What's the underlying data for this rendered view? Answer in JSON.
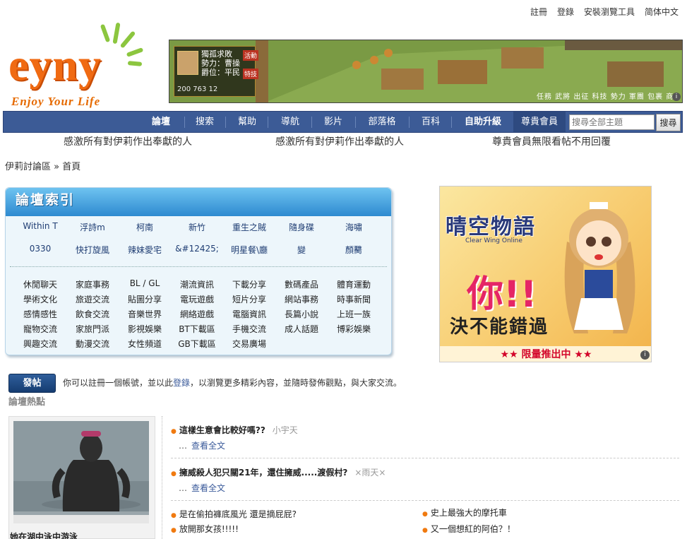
{
  "top_links": [
    "註冊",
    "登錄",
    "安裝瀏覽工具",
    "简体中文"
  ],
  "logo": {
    "word": "eyny",
    "slogan": "Enjoy Your Life"
  },
  "banner": {
    "info_lines": [
      "獨孤求敗",
      "勢力：曹操",
      "爵位：平民"
    ],
    "stats": "200  763  12",
    "tags": [
      "活動",
      "特技"
    ],
    "strip": "任務 武將 出征 科技 勢力 軍團 包裹 商"
  },
  "nav": {
    "items": [
      "論壇",
      "搜索",
      "幫助",
      "導航",
      "影片",
      "部落格",
      "百科",
      "自助升級",
      "尊貴會員"
    ],
    "search_placeholder": "搜尋全部主題",
    "search_button": "搜尋"
  },
  "notices": [
    "感激所有對伊莉作出奉獻的人",
    "感激所有對伊莉作出奉獻的人",
    "尊貴會員無限看帖不用回覆"
  ],
  "breadcrumb": {
    "home": "伊莉討論區",
    "sep": "»",
    "current": "首頁"
  },
  "forum_index": {
    "title": "論壇索引",
    "row1": [
      "Within T",
      "浮詩m",
      "柯南",
      "新竹",
      "重生之賊",
      "隨身碟",
      "海嘯"
    ],
    "row2": [
      "0330",
      "快打旋風",
      "辣妹愛宅",
      "&#12425;",
      "明星餐\\廳",
      "變",
      "顏臡"
    ],
    "columns": [
      [
        "休閒聊天",
        "學術文化",
        "感情感性",
        "寵物交流",
        "興趣交流"
      ],
      [
        "家庭事務",
        "旅遊交流",
        "飲食交流",
        "家旅門派",
        "動漫交流"
      ],
      [
        "BL / GL",
        "貼圖分享",
        "音樂世界",
        "影視娛樂",
        "女性頻道"
      ],
      [
        "潮流資訊",
        "電玩遊戲",
        "網絡遊戲",
        "BT下載區",
        "GB下載區"
      ],
      [
        "下載分享",
        "短片分享",
        "電腦資訊",
        "手機交流",
        "交易廣場"
      ],
      [
        "數碼產品",
        "網站事務",
        "長篇小說",
        "成人話題"
      ],
      [
        "體育運動",
        "時事新聞",
        "上班一族",
        "博彩娛樂"
      ]
    ]
  },
  "ad": {
    "logo": "晴空物語",
    "logo_sub": "Clear Wing Online",
    "headline": "你!!",
    "main": "決不能錯過",
    "sub": "★★ 限量推出中 ★★"
  },
  "post_button": "發帖",
  "intro": {
    "before": "你可以註冊一個帳號，並以此",
    "link": "登錄",
    "after": "，以瀏覽更多精彩內容，並隨時發佈觀點，與大家交流。"
  },
  "hot": {
    "title": "論壇熱點",
    "featured": [
      {
        "title": "這樣生意會比較好嗎??",
        "author": "小宇天",
        "more": "查看全文"
      },
      {
        "title": "擁威殺人犯只關21年，還住擁威.....渡假村?",
        "author": "×雨天×",
        "more": "查看全文"
      }
    ],
    "list_left": [
      "是在偷拍褲底風光 還是摘屁屁?",
      "放開那女孩!!!!!"
    ],
    "list_right": [
      "史上最強大的摩托車",
      "又一個想紅的阿伯？！"
    ],
    "photo_caption": "她在湖中泳中游泳"
  },
  "colors": {
    "nav_bg": "#3c5b96",
    "index_head": "#2e8ad0",
    "accent_orange": "#f07a10",
    "link": "#3a5a9a"
  }
}
